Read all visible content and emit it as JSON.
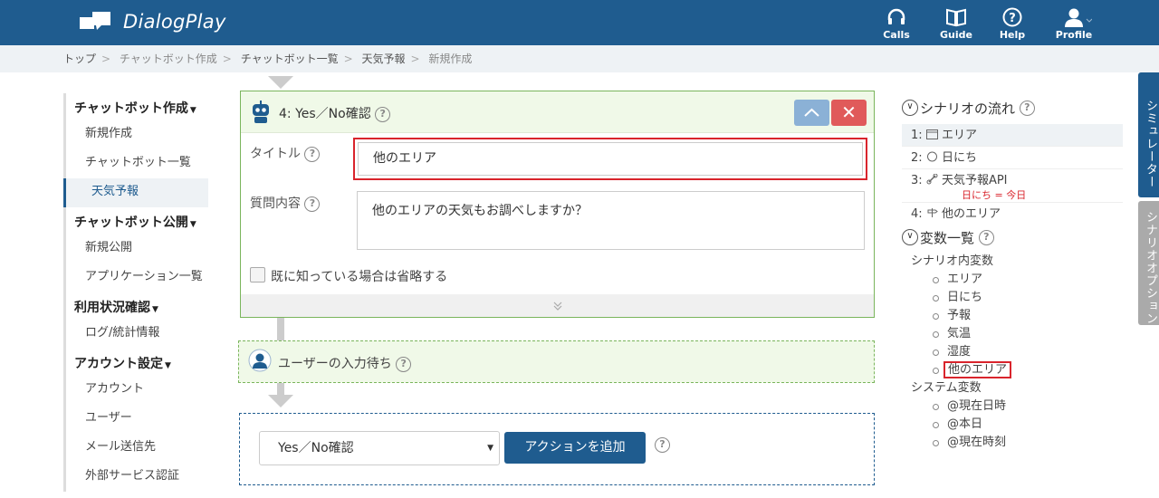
{
  "app": {
    "title": "DialogPlay"
  },
  "nav": [
    {
      "label": "Calls",
      "icon": "headset-icon"
    },
    {
      "label": "Guide",
      "icon": "book-icon"
    },
    {
      "label": "Help",
      "icon": "question-icon"
    },
    {
      "label": "Profile",
      "icon": "user-icon"
    }
  ],
  "breadcrumb": [
    "トップ",
    "チャットボット作成",
    "チャットボット一覧",
    "天気予報",
    "新規作成"
  ],
  "sidebar": {
    "sections": [
      {
        "head": "チャットボット作成",
        "items": [
          "新規作成",
          "チャットボット一覧",
          "天気予報"
        ]
      },
      {
        "head": "チャットボット公開",
        "items": [
          "新規公開",
          "アプリケーション一覧"
        ]
      },
      {
        "head": "利用状況確認",
        "items": [
          "ログ/統計情報"
        ]
      },
      {
        "head": "アカウント設定",
        "items": [
          "アカウント",
          "ユーザー",
          "メール送信先",
          "外部サービス認証"
        ]
      }
    ]
  },
  "card": {
    "title": "4: Yes／No確認",
    "title_label": "タイトル",
    "title_value": "他のエリア",
    "question_label": "質問内容",
    "question_value": "他のエリアの天気もお調べしますか？",
    "checkbox_label": "既に知っている場合は省略する",
    "close_symbol": "✕"
  },
  "wait": {
    "label": "ユーザーの入力待ち"
  },
  "action": {
    "select_value": "Yes／No確認",
    "add_button": "アクションを追加"
  },
  "right": {
    "flow_head": "シナリオの流れ",
    "flow": [
      {
        "num": "1:",
        "label": "エリア"
      },
      {
        "num": "2:",
        "label": "日にち"
      },
      {
        "num": "3:",
        "label": "天気予報API",
        "sub": "日にち = 今日"
      },
      {
        "num": "4:",
        "label": "他のエリア"
      }
    ],
    "vars_head": "変数一覧",
    "scenario_vars_label": "シナリオ内変数",
    "scenario_vars": [
      "エリア",
      "日にち",
      "予報",
      "気温",
      "湿度",
      "他のエリア"
    ],
    "system_vars_label": "システム変数",
    "system_vars": [
      "@現在日時",
      "@本日",
      "@現在時刻"
    ]
  },
  "tabs": {
    "simulator": "シミュレーター",
    "options": "シナリオオプション"
  }
}
